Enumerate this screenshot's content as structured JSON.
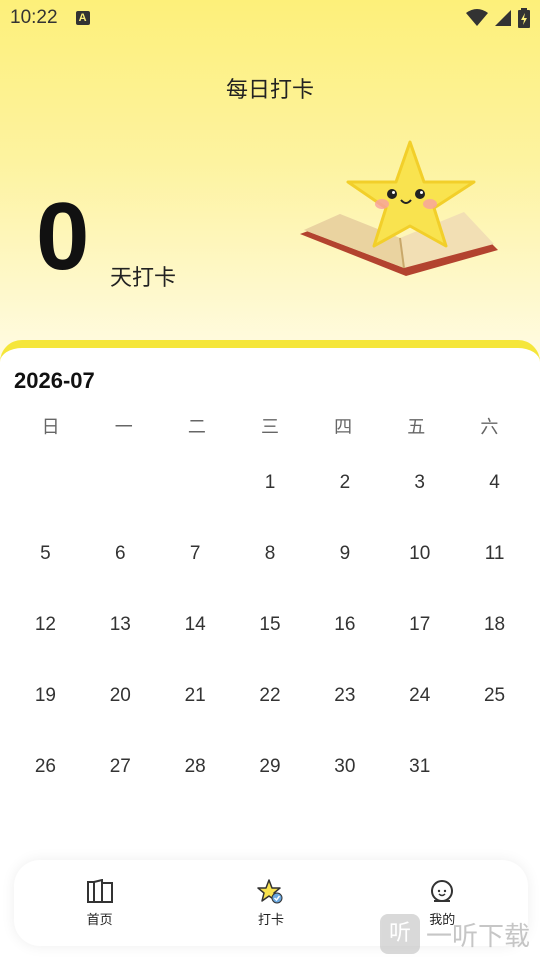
{
  "status": {
    "time": "10:22",
    "notification_letter": "A"
  },
  "header": {
    "title": "每日打卡"
  },
  "streak": {
    "count": "0",
    "unit": "天打卡"
  },
  "calendar": {
    "month": "2026-07",
    "weekdays": [
      "日",
      "一",
      "二",
      "三",
      "四",
      "五",
      "六"
    ],
    "leading_blanks": 3,
    "days": [
      "1",
      "2",
      "3",
      "4",
      "5",
      "6",
      "7",
      "8",
      "9",
      "10",
      "11",
      "12",
      "13",
      "14",
      "15",
      "16",
      "17",
      "18",
      "19",
      "20",
      "21",
      "22",
      "23",
      "24",
      "25",
      "26",
      "27",
      "28",
      "29",
      "30",
      "31"
    ]
  },
  "tabs": [
    {
      "label": "首页",
      "icon": "book-icon"
    },
    {
      "label": "打卡",
      "icon": "star-checkin-icon"
    },
    {
      "label": "我的",
      "icon": "profile-face-icon"
    }
  ],
  "watermark": {
    "text": "一听下载",
    "glyph": "听"
  },
  "colors": {
    "accent": "#f5e63a",
    "hero_top": "#fdf07a"
  }
}
